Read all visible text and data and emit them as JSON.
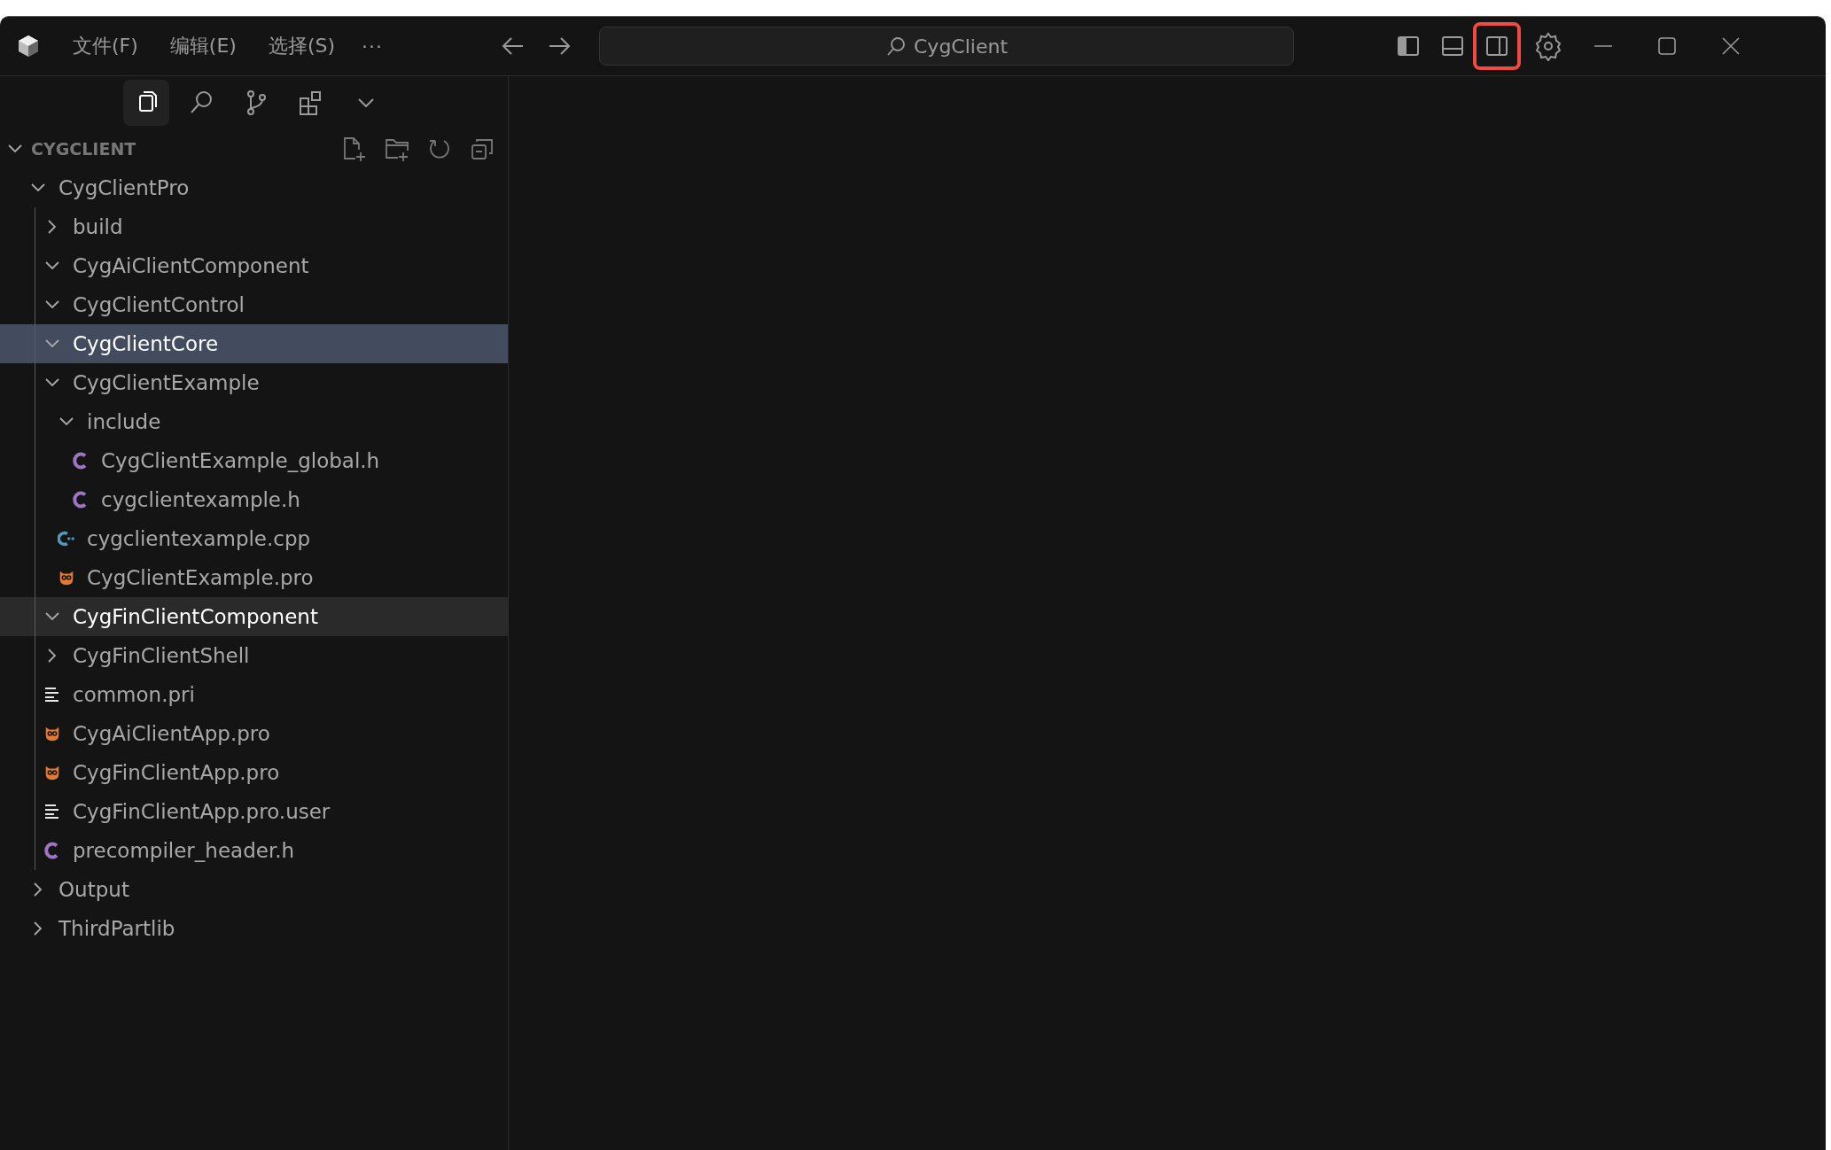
{
  "title_bar": {
    "menus": [
      "文件(F)",
      "编辑(E)",
      "选择(S)"
    ],
    "more": "···",
    "command_center": {
      "title": "CygClient"
    },
    "layout_toggles": [
      {
        "kind": "primary-sidebar",
        "on": true,
        "highlighted": false
      },
      {
        "kind": "panel",
        "on": false,
        "highlighted": false
      },
      {
        "kind": "secondary-sidebar",
        "on": false,
        "highlighted": true
      }
    ]
  },
  "activity_bar": [
    {
      "kind": "explorer",
      "selected": true
    },
    {
      "kind": "search",
      "selected": false
    },
    {
      "kind": "source-control",
      "selected": false
    },
    {
      "kind": "extensions",
      "selected": false
    },
    {
      "kind": "more",
      "selected": false
    }
  ],
  "explorer": {
    "title": "CYGCLIENT",
    "expanded": true,
    "tree": [
      {
        "label": "CygClientPro",
        "kind": "folder",
        "expanded": true,
        "selected": false,
        "focused": false,
        "children": [
          {
            "label": "build",
            "kind": "folder",
            "expanded": false,
            "selected": false,
            "focused": false
          },
          {
            "label": "CygAiClientComponent",
            "kind": "folder",
            "expanded": true,
            "selected": false,
            "focused": false
          },
          {
            "label": "CygClientControl",
            "kind": "folder",
            "expanded": true,
            "selected": false,
            "focused": false
          },
          {
            "label": "CygClientCore",
            "kind": "folder",
            "expanded": true,
            "selected": true,
            "focused": false
          },
          {
            "label": "CygClientExample",
            "kind": "folder",
            "expanded": true,
            "selected": false,
            "focused": false,
            "children": [
              {
                "label": "include",
                "kind": "folder",
                "expanded": true,
                "selected": false,
                "focused": false,
                "children": [
                  {
                    "label": "CygClientExample_global.h",
                    "kind": "c",
                    "selected": false,
                    "focused": false
                  },
                  {
                    "label": "cygclientexample.h",
                    "kind": "c",
                    "selected": false,
                    "focused": false
                  }
                ]
              },
              {
                "label": "cygclientexample.cpp",
                "kind": "cpp",
                "selected": false,
                "focused": false
              },
              {
                "label": "CygClientExample.pro",
                "kind": "qt-project",
                "selected": false,
                "focused": false
              }
            ]
          },
          {
            "label": "CygFinClientComponent",
            "kind": "folder",
            "expanded": true,
            "selected": false,
            "focused": true
          },
          {
            "label": "CygFinClientShell",
            "kind": "folder",
            "expanded": false,
            "selected": false,
            "focused": false
          },
          {
            "label": "common.pri",
            "kind": "text",
            "selected": false,
            "focused": false
          },
          {
            "label": "CygAiClientApp.pro",
            "kind": "qt-project",
            "selected": false,
            "focused": false
          },
          {
            "label": "CygFinClientApp.pro",
            "kind": "qt-project",
            "selected": false,
            "focused": false
          },
          {
            "label": "CygFinClientApp.pro.user",
            "kind": "text",
            "selected": false,
            "focused": false
          },
          {
            "label": "precompiler_header.h",
            "kind": "c",
            "selected": false,
            "focused": false
          }
        ]
      },
      {
        "label": "Output",
        "kind": "folder",
        "expanded": false,
        "selected": false,
        "focused": false
      },
      {
        "label": "ThirdPartlib",
        "kind": "folder",
        "expanded": false,
        "selected": false,
        "focused": false
      }
    ]
  }
}
